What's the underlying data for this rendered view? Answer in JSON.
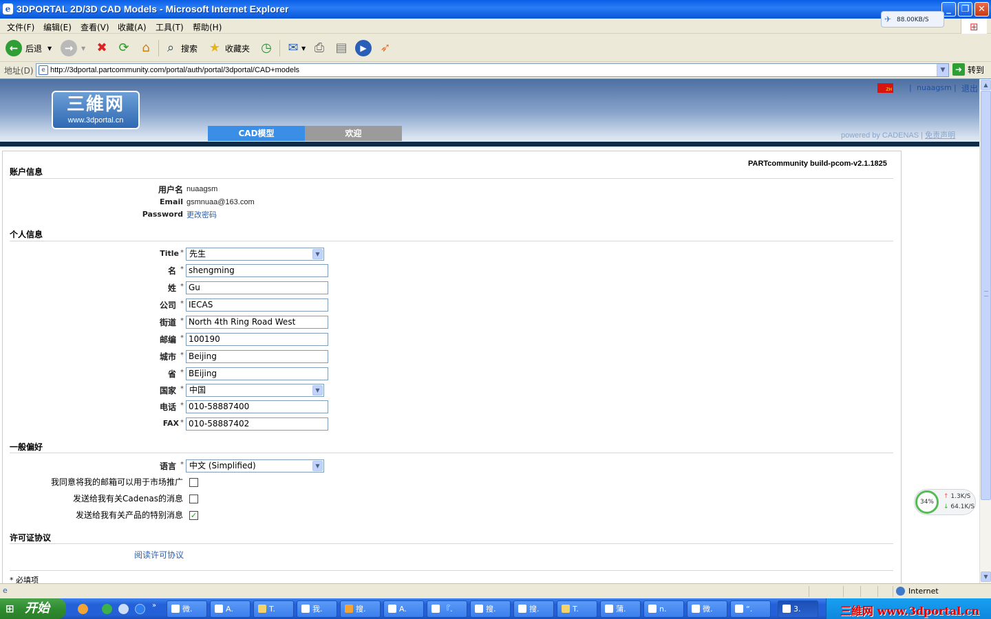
{
  "window": {
    "title": "3DPORTAL 2D/3D CAD Models - Microsoft Internet Explorer",
    "netspeed": "88.00KB/S"
  },
  "menu": [
    "文件(F)",
    "编辑(E)",
    "查看(V)",
    "收藏(A)",
    "工具(T)",
    "帮助(H)"
  ],
  "toolbar": {
    "back": "后退",
    "search": "搜索",
    "favorites": "收藏夹"
  },
  "address": {
    "label": "地址(D)",
    "url": "http://3dportal.partcommunity.com/portal/auth/portal/3dportal/CAD+models",
    "go": "转到"
  },
  "site": {
    "logo_zh": "三維网",
    "logo_en": "www.3dportal.cn",
    "tabs": [
      "CAD模型",
      "欢迎"
    ],
    "user": "nuaagsm",
    "logout": "退出",
    "powered": "powered by CADENAS",
    "disclaimer": "免责声明",
    "flag_text": "ZH"
  },
  "form": {
    "build": "PARTcommunity build-pcom-v2.1.1825",
    "account": {
      "title": "账户信息",
      "username_label": "用户名",
      "username": "nuaagsm",
      "email_label": "Email",
      "email": "gsmnuaa@163.com",
      "password_label": "Password",
      "password_link": "更改密码"
    },
    "personal": {
      "title": "个人信息",
      "title_label": "Title",
      "title_value": "先生",
      "first_label": "名",
      "first": "shengming",
      "last_label": "姓",
      "last": "Gu",
      "company_label": "公司",
      "company": "IECAS",
      "street_label": "街道",
      "street": "North 4th Ring Road West",
      "zip_label": "邮编",
      "zip": "100190",
      "city_label": "城市",
      "city": "Beijing",
      "province_label": "省",
      "province": "BEijing",
      "country_label": "国家",
      "country": "中国",
      "phone_label": "电话",
      "phone": "010-58887400",
      "fax_label": "FAX",
      "fax": "010-58887402"
    },
    "prefs": {
      "title": "一般偏好",
      "lang_label": "语言",
      "lang": "中文 (Simplified)",
      "marketing": "我同意将我的邮箱可以用于市场推广",
      "cadenas": "发送给我有关Cadenas的消息",
      "special": "发送给我有关产品的特别消息",
      "marketing_checked": false,
      "cadenas_checked": false,
      "special_checked": true
    },
    "license": {
      "title": "许可证协议",
      "link": "阅读许可协议"
    },
    "required_note": "* 必填项"
  },
  "netwidget": {
    "percent": "34%",
    "up": "1.3K/S",
    "down": "64.1K/S"
  },
  "status": {
    "zone": "Internet"
  },
  "taskbar": {
    "start": "开始",
    "tasks": [
      "微.",
      "A.",
      "T.",
      "我.",
      "搜.",
      "A.",
      "『.",
      "搜.",
      "搜.",
      "T.",
      "蒲.",
      "n.",
      "微.",
      "“.",
      "3."
    ],
    "watermark": "三維网 www.3dportal.cn"
  }
}
